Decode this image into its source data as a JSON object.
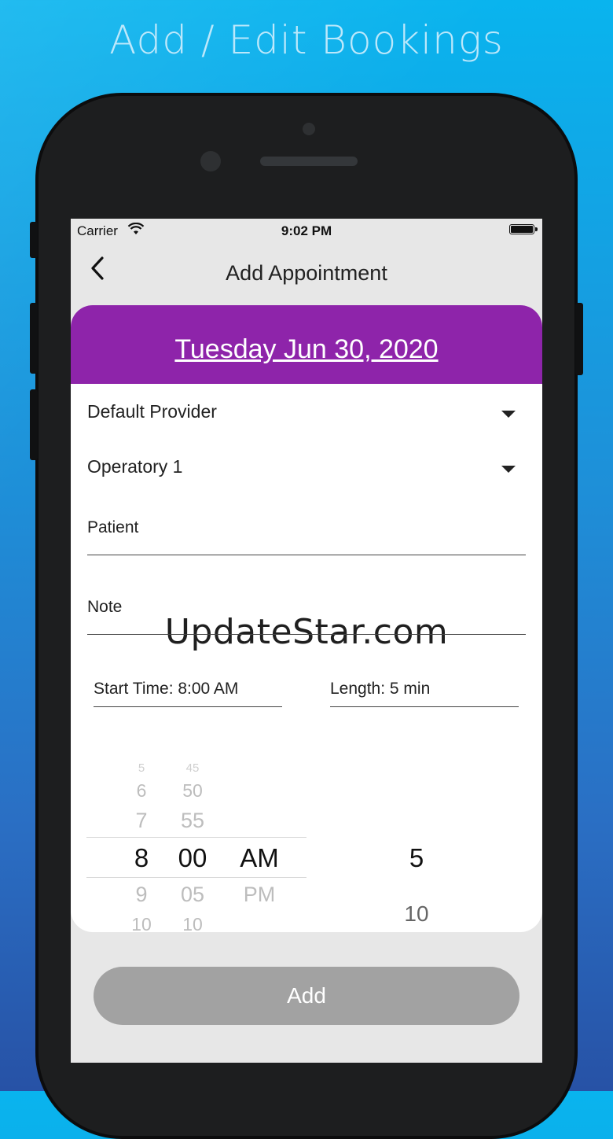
{
  "headline": "Add / Edit Bookings",
  "status_bar": {
    "carrier": "Carrier",
    "wifi_icon": "wifi-icon",
    "time": "9:02 PM",
    "battery_icon": "battery-icon"
  },
  "nav": {
    "back_icon": "chevron-left-icon",
    "title": "Add Appointment"
  },
  "date": "Tuesday Jun 30, 2020",
  "provider": {
    "value": "Default Provider",
    "icon": "caret-down-icon"
  },
  "operatory": {
    "value": "Operatory 1",
    "icon": "caret-down-icon"
  },
  "patient_label": "Patient",
  "note_label": "Note",
  "start_time": "Start Time: 8:00 AM",
  "length": "Length: 5 min",
  "watermark": "UpdateStar.com",
  "time_picker": {
    "hours": [
      "5",
      "6",
      "7",
      "8",
      "9",
      "10"
    ],
    "minutes": [
      "45",
      "50",
      "55",
      "00",
      "05",
      "10"
    ],
    "period": [
      "AM",
      "PM"
    ],
    "selected": {
      "hour": "8",
      "minute": "00",
      "period": "AM"
    }
  },
  "length_picker": {
    "selected": "5",
    "next": "10"
  },
  "add_button": "Add",
  "colors": {
    "date_band": "#8e24aa",
    "add_button": "#a2a2a2",
    "background": "#1e8fd8"
  }
}
